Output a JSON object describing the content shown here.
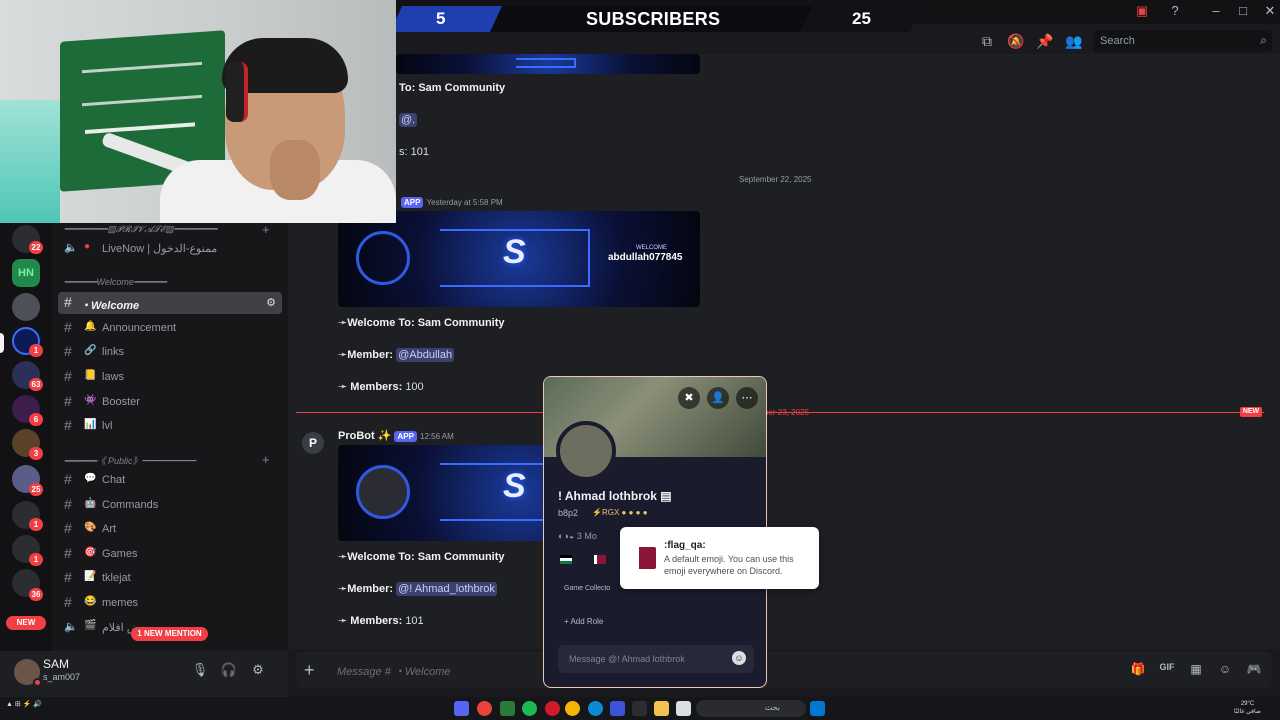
{
  "subscribers": {
    "left_count": "5",
    "label": "SUBSCRIBERS",
    "right_count": "25"
  },
  "header": {
    "search_placeholder": "Search"
  },
  "server_rail": {
    "badges": [
      "22",
      "1",
      "63",
      "6",
      "3",
      "25",
      "1",
      "1",
      "36"
    ],
    "new_label": "NEW",
    "server_hn": "HN"
  },
  "channels": {
    "categories": [
      {
        "label": "━━━━━━━━▨𝓟𝓡𝓘𝓥𝓐𝓣𝓔▨━━━━━━━━"
      },
      {
        "label": "━━━━━━Welcome━━━━━━"
      },
      {
        "label": "━━━━━━《 Public》━━━━━━"
      }
    ],
    "items": [
      {
        "label": "LiveNow | ممنوع-الدخول",
        "icon": "speaker-icon"
      },
      {
        "label": "・Welcome",
        "icon": "hash"
      },
      {
        "label": "Announcement",
        "emoji": "🔔"
      },
      {
        "label": "links",
        "emoji": "🔗"
      },
      {
        "label": "laws",
        "emoji": "📒"
      },
      {
        "label": "Booster",
        "emoji": "👾"
      },
      {
        "label": "lvl",
        "emoji": "📊"
      },
      {
        "label": "Chat",
        "emoji": "💬"
      },
      {
        "label": "Commands",
        "emoji": "🤖"
      },
      {
        "label": "Art",
        "emoji": "🎨"
      },
      {
        "label": "Games",
        "emoji": "🎯"
      },
      {
        "label": "tklejat",
        "emoji": "📝"
      },
      {
        "label": "memes",
        "emoji": "😂"
      },
      {
        "label": "بعض افلام",
        "emoji": "🎬"
      }
    ],
    "mention_pill": "1 NEW MENTION"
  },
  "user": {
    "name": "SAM",
    "tag": "s_am007"
  },
  "chat": {
    "msg1": {
      "welcome_line": "To: Sam Community",
      "member_line": "@.",
      "members_line": "s: 101"
    },
    "date_divider_1": "September 22, 2025",
    "msg2": {
      "app_tag": "APP",
      "timestamp": "Yesterday at 5:58 PM",
      "banner_welcome": "WELCOME",
      "banner_name": "abdullah077845",
      "welcome_prefix": "Welcome To:",
      "welcome_value": "Sam Community",
      "member_prefix": "Member:",
      "member_value": "@Abdullah",
      "members_prefix": "Members:",
      "members_value": "100"
    },
    "date_divider_2": "ber 23, 2025",
    "new_tag": "NEW",
    "msg3": {
      "author": "ProBot",
      "app_tag": "APP",
      "timestamp": "12:56 AM",
      "welcome_prefix": "Welcome To:",
      "welcome_value": "Sam Community",
      "member_prefix": "Member:",
      "member_value": "@!      Ahmad_lothbrok",
      "members_prefix": "Members:",
      "members_value": "101"
    }
  },
  "composer": {
    "placeholder": "Message # ・Welcome"
  },
  "profile_popup": {
    "name": "! Ahmad lothbrok",
    "tag": "b8p2",
    "guild_tag": "RGX",
    "since": "3 Mo",
    "roles_head": "Game Collecto",
    "add_role": "Add Role",
    "message_placeholder": "Message @! Ahmad lothbrok"
  },
  "tooltip": {
    "title": ":flag_qa:",
    "description": "A default emoji. You can use this emoji everywhere on Discord."
  },
  "taskbar": {
    "search_text": "بحث",
    "clock_line1": "29°C",
    "clock_line2": "صافي غالبًا"
  }
}
